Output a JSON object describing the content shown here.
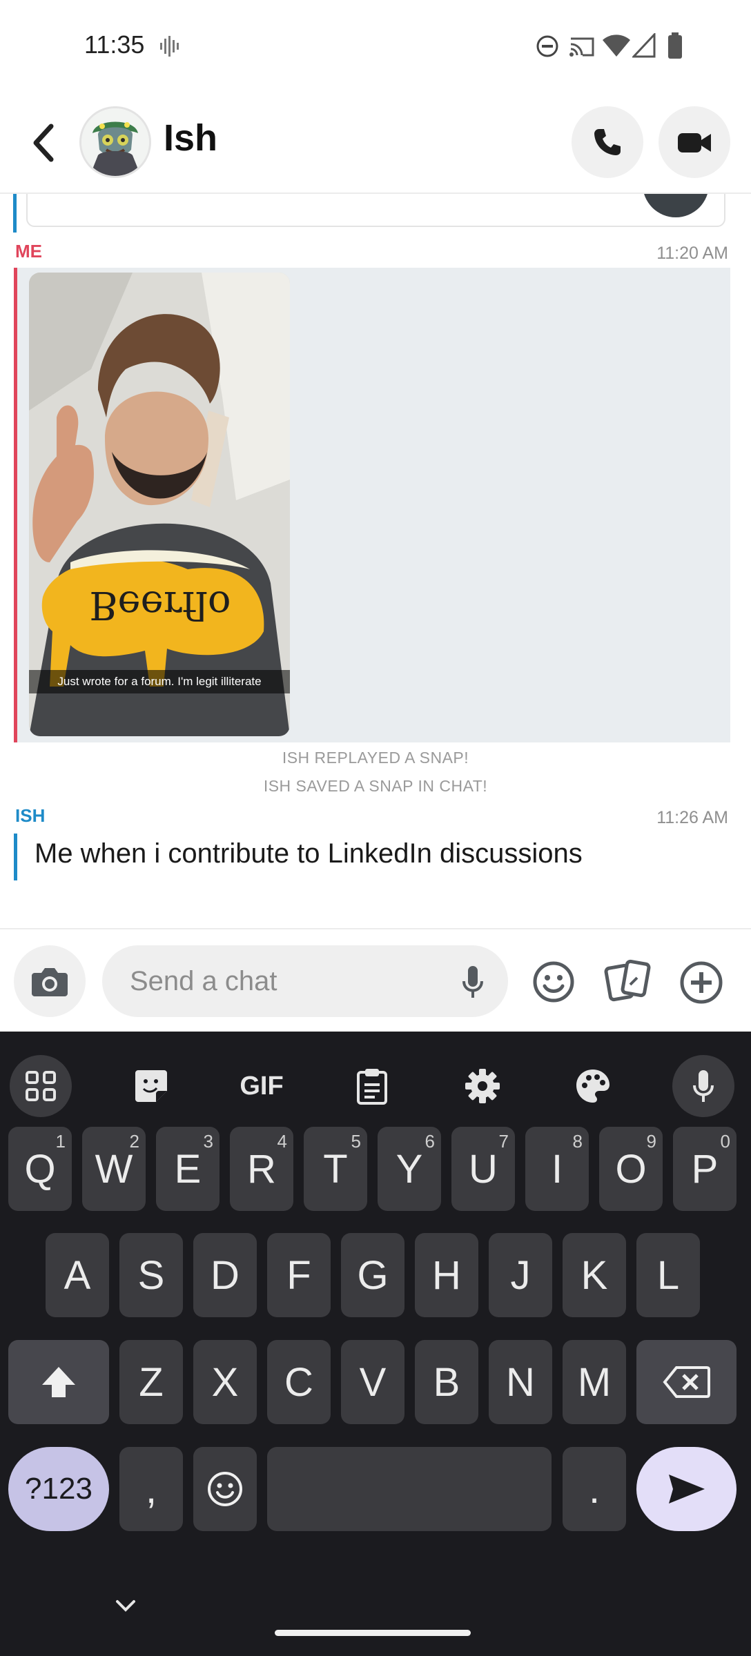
{
  "status_bar": {
    "time": "11:35"
  },
  "header": {
    "contact_name": "Ish"
  },
  "messages": {
    "me": {
      "sender": "ME",
      "time": "11:20 AM",
      "snap_caption": "Just wrote for a forum. I'm legit illiterate",
      "shirt_text": "Beerflo"
    },
    "system": [
      "ISH REPLAYED A SNAP!",
      "ISH SAVED A SNAP IN CHAT!"
    ],
    "ish": {
      "sender": "ISH",
      "time": "11:26 AM",
      "text": "Me when i contribute to LinkedIn discussions"
    }
  },
  "input": {
    "placeholder": "Send a chat"
  },
  "keyboard": {
    "toolbar": {
      "gif_label": "GIF"
    },
    "row1": [
      {
        "key": "Q",
        "hint": "1"
      },
      {
        "key": "W",
        "hint": "2"
      },
      {
        "key": "E",
        "hint": "3"
      },
      {
        "key": "R",
        "hint": "4"
      },
      {
        "key": "T",
        "hint": "5"
      },
      {
        "key": "Y",
        "hint": "6"
      },
      {
        "key": "U",
        "hint": "7"
      },
      {
        "key": "I",
        "hint": "8"
      },
      {
        "key": "O",
        "hint": "9"
      },
      {
        "key": "P",
        "hint": "0"
      }
    ],
    "row2": [
      "A",
      "S",
      "D",
      "F",
      "G",
      "H",
      "J",
      "K",
      "L"
    ],
    "row3": [
      "Z",
      "X",
      "C",
      "V",
      "B",
      "N",
      "M"
    ],
    "row4": {
      "symbols": "?123",
      "comma": ",",
      "period": "."
    }
  },
  "colors": {
    "me_accent": "#e0455b",
    "ish_accent": "#1e8bc8",
    "snap_background": "#e9edf0",
    "keyboard_background": "#1b1b1f",
    "key": "#3b3b3f",
    "accent_key": "#c6c3e6"
  }
}
